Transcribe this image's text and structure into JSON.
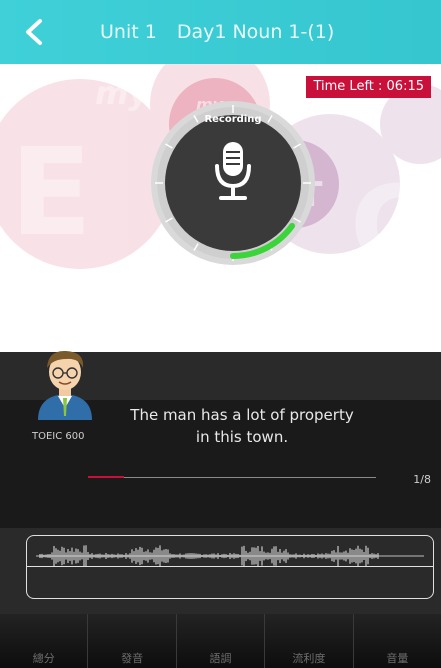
{
  "header": {
    "unit": "Unit 1",
    "lesson": "Day1 Noun 1-(1)"
  },
  "recorder": {
    "time_left": "Time Left : 06:15",
    "status": "Recording",
    "progress": 0.15
  },
  "sentence": {
    "line1": "The man has a lot of property",
    "line2": "in this town.",
    "level": "TOEIC 600"
  },
  "progress": {
    "counter": "1/8",
    "fraction": 0.125
  },
  "watermark": {
    "logo": "myET"
  },
  "tabs": [
    "總分",
    "發音",
    "語調",
    "流利度",
    "音量"
  ],
  "colors": {
    "header": "#3fd0d8",
    "accent_red": "#c8103b",
    "record_green": "#3bd43a"
  }
}
